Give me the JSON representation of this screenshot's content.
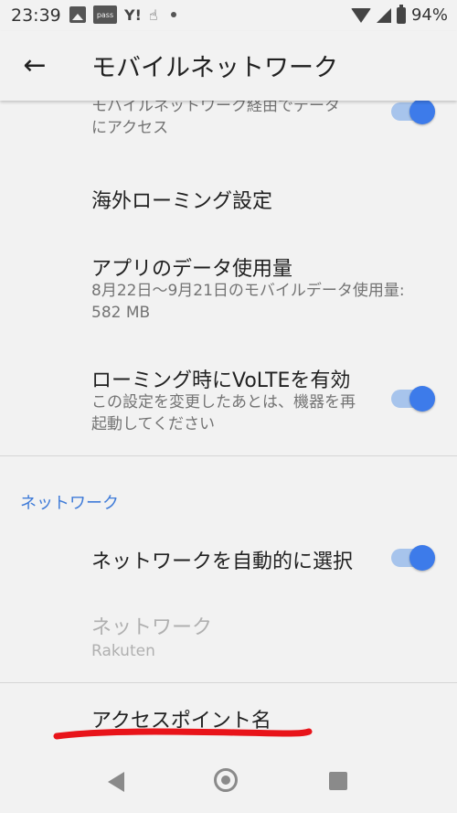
{
  "status_bar": {
    "time": "23:39",
    "notif_pass": "pass",
    "notif_yahoo": "Y!",
    "battery_pct": "94%",
    "icons": [
      "image-icon",
      "pass-icon",
      "yahoo-icon",
      "hand-icon",
      "dot-icon",
      "wifi-icon",
      "signal-icon",
      "battery-icon"
    ]
  },
  "app_bar": {
    "title": "モバイルネットワーク",
    "back_icon": "arrow-left-icon"
  },
  "settings": {
    "mobile_data": {
      "summary": "モバイルネットワーク経由でデータにアクセス",
      "enabled": true
    },
    "roaming": {
      "title": "海外ローミング設定"
    },
    "app_data_usage": {
      "title": "アプリのデータ使用量",
      "summary": "8月22日～9月21日のモバイルデータ使用量: 582 MB"
    },
    "volte_roaming": {
      "title": "ローミング時にVoLTEを有効",
      "summary": "この設定を変更したあとは、機器を再起動してください",
      "enabled": true
    },
    "network_section": {
      "label": "ネットワーク",
      "auto_select": {
        "title": "ネットワークを自動的に選択",
        "enabled": true
      },
      "network": {
        "title": "ネットワーク",
        "value": "Rakuten"
      }
    },
    "apn": {
      "title": "アクセスポイント名"
    }
  },
  "colors": {
    "accent": "#3d7bea",
    "toggle_track": "#a7c4ec",
    "annotation": "#e8141a",
    "background": "#f2f2f2"
  },
  "nav_bar": {
    "icons": [
      "nav-back-icon",
      "nav-home-icon",
      "nav-recent-icon"
    ]
  }
}
